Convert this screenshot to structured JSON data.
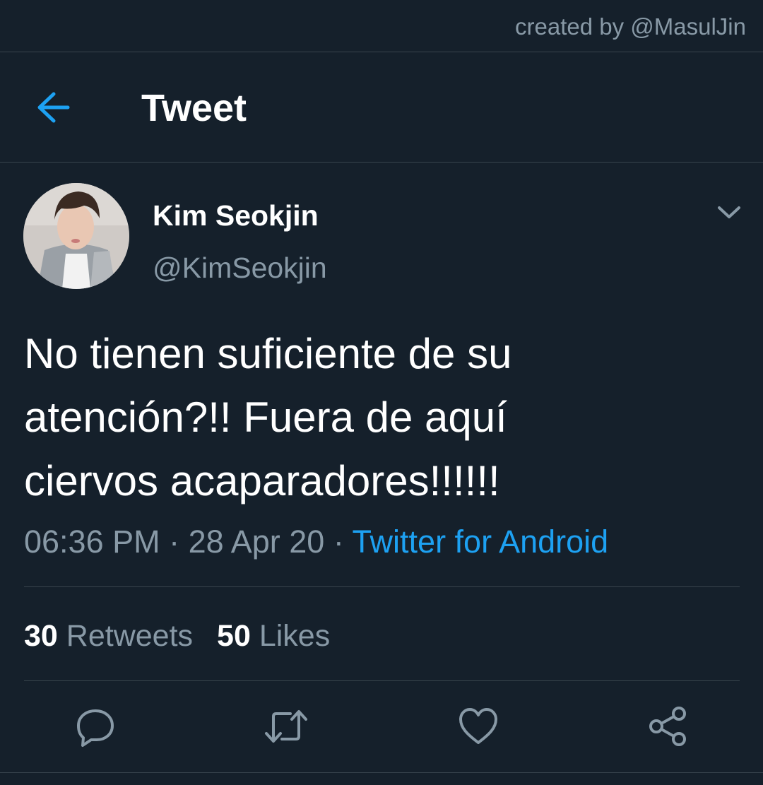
{
  "credit": "created by @MasulJin",
  "header": {
    "title": "Tweet",
    "back_icon": "arrow-left-icon"
  },
  "colors": {
    "background": "#15202b",
    "accent": "#1da1f2",
    "secondary_text": "#8899a6",
    "divider": "#38444d"
  },
  "tweet": {
    "author": {
      "name": "Kim Seokjin",
      "handle": "@KimSeokjin"
    },
    "text_lines": [
      "No tienen suficiente de su",
      "atención?!! Fuera de aquí",
      "ciervos acaparadores!!!!!!"
    ],
    "time": "06:36 PM",
    "date": "28 Apr 20",
    "separator": "·",
    "source": "Twitter for Android"
  },
  "stats": {
    "retweets_count": "30",
    "retweets_label": "Retweets",
    "likes_count": "50",
    "likes_label": "Likes"
  },
  "actions": [
    {
      "icon": "reply-icon"
    },
    {
      "icon": "retweet-icon"
    },
    {
      "icon": "like-heart-icon"
    },
    {
      "icon": "share-icon"
    }
  ]
}
